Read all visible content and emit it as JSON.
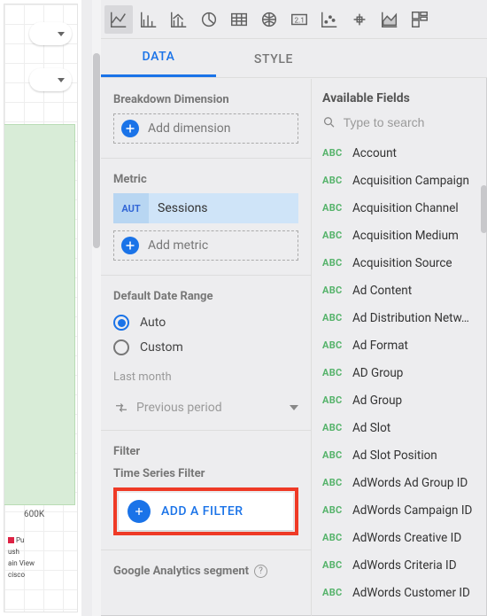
{
  "tabs": {
    "data": "DATA",
    "style": "STYLE"
  },
  "breakdown": {
    "title": "Breakdown Dimension",
    "add": "Add dimension"
  },
  "metric": {
    "title": "Metric",
    "tag": "AUT",
    "value": "Sessions",
    "add": "Add metric"
  },
  "dateRange": {
    "title": "Default Date Range",
    "auto": "Auto",
    "custom": "Custom",
    "summary": "Last month",
    "compare": "Previous period"
  },
  "filter": {
    "title": "Filter",
    "subtitle": "Time Series Filter",
    "button": "ADD A FILTER"
  },
  "gaSegment": {
    "title": "Google Analytics segment"
  },
  "fields": {
    "title": "Available Fields",
    "searchPlaceholder": "Type to search",
    "items": [
      "Account",
      "Acquisition Campaign",
      "Acquisition Channel",
      "Acquisition Medium",
      "Acquisition Source",
      "Ad Content",
      "Ad Distribution Netw…",
      "Ad Format",
      "AD Group",
      "Ad Group",
      "Ad Slot",
      "Ad Slot Position",
      "AdWords Ad Group ID",
      "AdWords Campaign ID",
      "AdWords Creative ID",
      "AdWords Criteria ID",
      "AdWords Customer ID"
    ]
  },
  "ghost": {
    "yLabel": "600K",
    "legend": [
      "Pu",
      "ush",
      "ain View",
      "cisco"
    ]
  }
}
